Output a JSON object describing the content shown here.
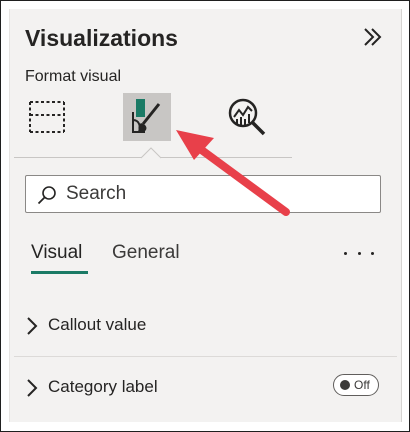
{
  "pane": {
    "title": "Visualizations",
    "subtitle": "Format visual"
  },
  "icons": {
    "collapse": "double-chevron-right-icon",
    "build_visual": "build-visual-icon",
    "format_visual": "format-paintbrush-icon",
    "analytics": "analytics-magnifier-icon",
    "search": "search-icon"
  },
  "search": {
    "placeholder": "Search",
    "value": ""
  },
  "tabs": [
    {
      "label": "Visual",
      "selected": true
    },
    {
      "label": "General",
      "selected": false
    }
  ],
  "sections": [
    {
      "label": "Callout value",
      "has_toggle": false
    },
    {
      "label": "Category label",
      "has_toggle": true,
      "toggle_label": "Off",
      "toggle_on": false
    }
  ],
  "colors": {
    "accent": "#1a7a65",
    "annotation_arrow": "#e8404a",
    "panel_bg": "#f3f2f1"
  }
}
